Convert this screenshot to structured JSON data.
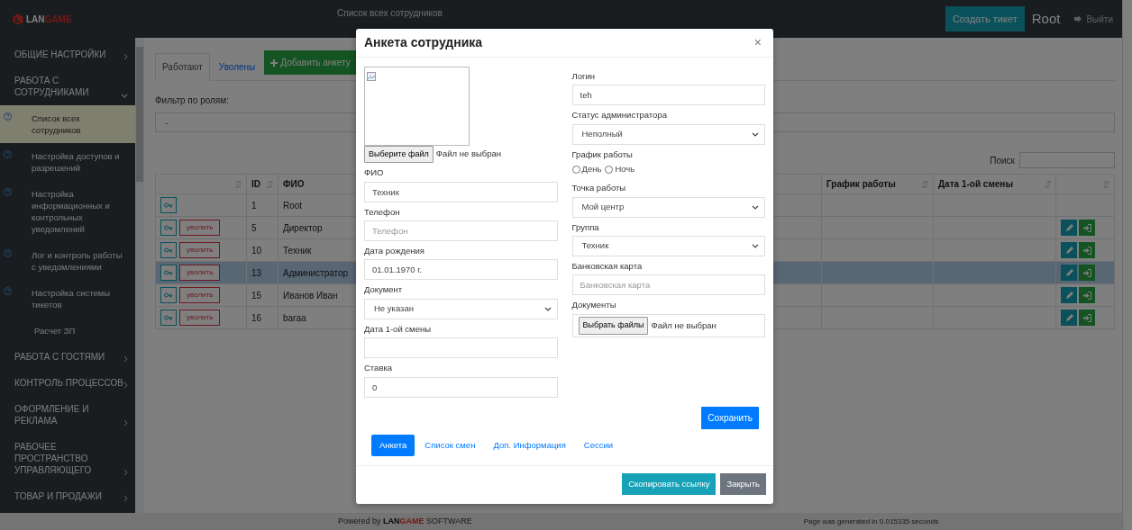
{
  "navbar": {
    "logo_a": "LAN",
    "logo_b": "GAME",
    "title": "Список всех сотрудников",
    "create_ticket": "Создать тикет",
    "user": "Root",
    "logout": "Выйти"
  },
  "sidebar": {
    "groups": [
      {
        "label": "ОБЩИЕ НАСТРОЙКИ",
        "expanded": false
      },
      {
        "label": "РАБОТА С СОТРУДНИКАМИ",
        "expanded": true,
        "children": [
          {
            "kind": "help",
            "label": "Список всех сотрудников",
            "selected": true
          },
          {
            "kind": "help",
            "label": "Настройка доступов и разрешений",
            "selected": false
          },
          {
            "kind": "help",
            "label": "Настройка информационных и контрольных уведомлений",
            "selected": false
          },
          {
            "kind": "help",
            "label": "Лог и контроль работы с уведомлениями",
            "selected": false
          },
          {
            "kind": "help",
            "label": "Настройка системы тикетов",
            "selected": false
          },
          {
            "kind": "plain",
            "label": "Расчет ЗП",
            "selected": false
          }
        ]
      },
      {
        "label": "РАБОТА С ГОСТЯМИ",
        "expanded": false
      },
      {
        "label": "КОНТРОЛЬ ПРОЦЕССОВ",
        "expanded": false
      },
      {
        "label": "ОФОРМЛЕНИЕ И РЕКЛАМА",
        "expanded": false
      },
      {
        "label": "РАБОЧЕЕ ПРОСТРАНСТВО УПРАВЛЯЮЩЕГО",
        "expanded": false
      },
      {
        "label": "ТОВАР И ПРОДАЖИ",
        "expanded": false
      }
    ]
  },
  "content": {
    "tabs": [
      {
        "label": "Работают",
        "selected": true
      },
      {
        "label": "Уволены",
        "selected": false
      }
    ],
    "add_button": "Добавить анкету",
    "filter_label": "Фильтр по ролям:",
    "filter_value": "-",
    "search_label": "Поиск",
    "table": {
      "columns": [
        {
          "sortable": true
        },
        {
          "label": "ID",
          "sortable": true
        },
        {
          "label": "ФИО",
          "sortable": false
        },
        {
          "label": "График работы",
          "sortable": true
        },
        {
          "label": "Дата 1-ой смены",
          "sortable": true
        },
        {
          "sortable": true
        }
      ],
      "rows": [
        {
          "id": "1",
          "name": "Root",
          "selected": false,
          "row_actions": false
        },
        {
          "id": "5",
          "name": "Директор",
          "fire_label": "уволить",
          "selected": false,
          "row_actions": true
        },
        {
          "id": "10",
          "name": "Техник",
          "fire_label": "уволить",
          "selected": false,
          "row_actions": true
        },
        {
          "id": "13",
          "name": "Администратор",
          "fire_label": "уволить",
          "selected": true,
          "row_actions": true
        },
        {
          "id": "15",
          "name": "Иванов Иван",
          "fire_label": "уволить",
          "selected": false,
          "row_actions": true
        },
        {
          "id": "16",
          "name": "baraa",
          "fire_label": "уволить",
          "selected": false,
          "row_actions": true
        }
      ]
    }
  },
  "modal": {
    "title": "Анкета сотрудника",
    "close": "×",
    "photo_button": "Выберите файл",
    "photo_status": "Файл не выбран",
    "left_fields": [
      {
        "kind": "text",
        "label": "ФИО",
        "value": "Техник"
      },
      {
        "kind": "text",
        "label": "Телефон",
        "placeholder": "Телефон"
      },
      {
        "kind": "text",
        "label": "Дата рождения",
        "value": "01.01.1970 г."
      },
      {
        "kind": "select",
        "label": "Документ",
        "value": "Не указан"
      },
      {
        "kind": "text",
        "label": "Дата 1-ой смены"
      },
      {
        "kind": "text",
        "label": "Ставка",
        "value": "0"
      }
    ],
    "right_fields": [
      {
        "kind": "text",
        "label": "Логин",
        "value": "teh"
      },
      {
        "kind": "select",
        "label": "Статус администратора",
        "value": "Неполный"
      },
      {
        "kind": "radio",
        "label": "График работы",
        "options": [
          {
            "label": "День",
            "checked": false
          },
          {
            "label": "Ночь",
            "checked": false
          }
        ]
      },
      {
        "kind": "select",
        "label": "Точка работы",
        "value": "Мой центр"
      },
      {
        "kind": "select",
        "label": "Группа",
        "value": "Техник"
      },
      {
        "kind": "text",
        "label": "Банковская карта",
        "placeholder": "Банковская карта"
      },
      {
        "kind": "file",
        "label": "Документы",
        "button": "Выбрать файлы",
        "status": "Файл не выбран"
      }
    ],
    "save_button": "Сохранить",
    "pills": [
      {
        "label": "Анкета",
        "selected": true
      },
      {
        "label": "Список смен",
        "selected": false
      },
      {
        "label": "Доп. Информация",
        "selected": false
      },
      {
        "label": "Сессии",
        "selected": false
      }
    ],
    "footer_buttons": [
      {
        "kind": "copy",
        "label": "Скопировать ссылку"
      },
      {
        "kind": "close",
        "label": "Закрыть"
      }
    ]
  },
  "footer": {
    "prefix": "Powered by",
    "brand_a": "LAN",
    "brand_b": "GAME",
    "suffix": "SOFTWARE",
    "generated": "Page was generated in 0.015335 seconds"
  }
}
